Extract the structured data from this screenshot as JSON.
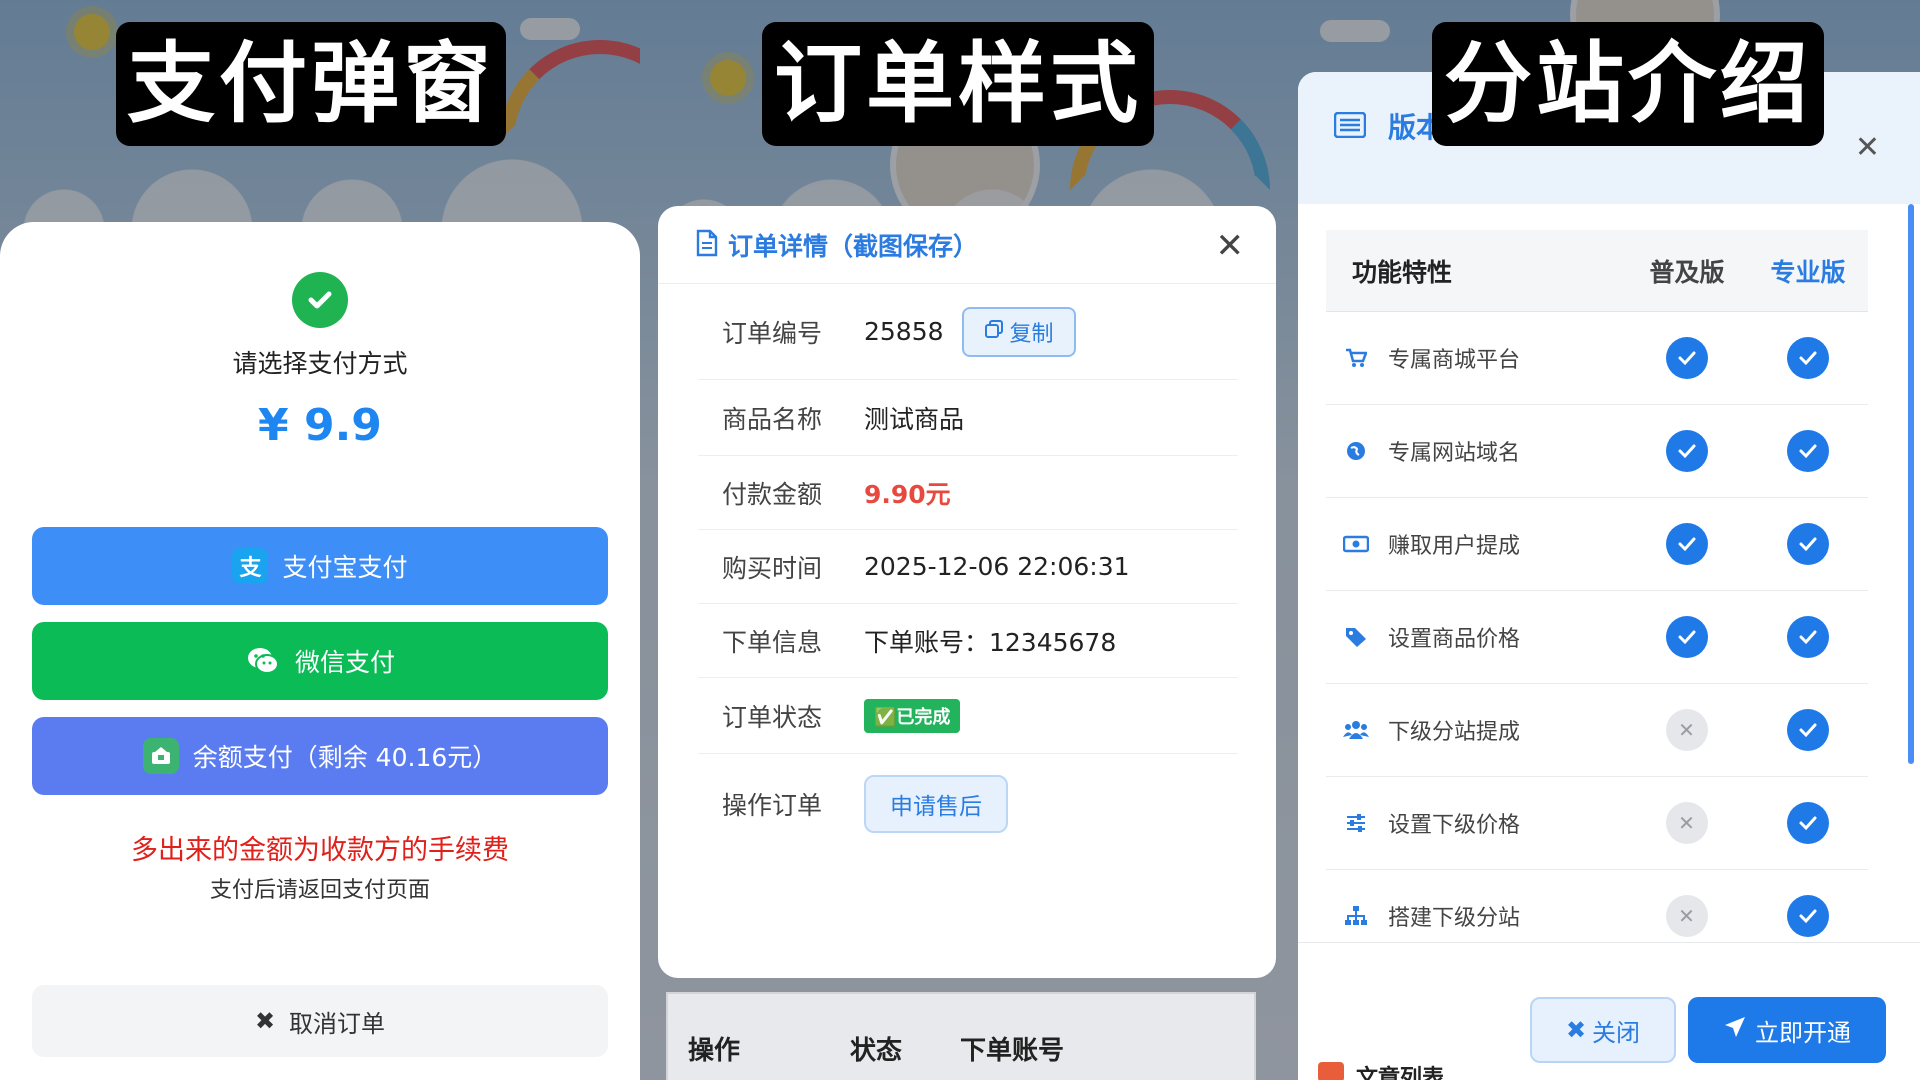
{
  "captions": {
    "payment": "支付弹窗",
    "order": "订单样式",
    "substation": "分站介绍"
  },
  "payment": {
    "title": "请选择支付方式",
    "amount": "¥ 9.9",
    "methods": [
      {
        "label": "支付宝支付",
        "icon": "alipay-icon",
        "icon_glyph": "支",
        "color": "#3d8ef7"
      },
      {
        "label": "微信支付",
        "icon": "wechat-icon",
        "icon_glyph": "",
        "color": "#0bbc56"
      },
      {
        "label": "余额支付（剩余 40.16元）",
        "icon": "wallet-icon",
        "icon_glyph": "",
        "color": "#5b7cf0"
      }
    ],
    "fee_note": "多出来的金额为收款方的手续费",
    "return_note": "支付后请返回支付页面",
    "cancel_label": "取消订单"
  },
  "order": {
    "title": "订单详情（截图保存）",
    "rows": [
      {
        "label": "订单编号",
        "value": "25858"
      },
      {
        "label": "商品名称",
        "value": "测试商品"
      },
      {
        "label": "付款金额",
        "value": "9.90元"
      },
      {
        "label": "购买时间",
        "value": "2025-12-06 22:06:31"
      },
      {
        "label": "下单信息",
        "value": "下单账号：12345678"
      },
      {
        "label": "订单状态",
        "value": "✅已完成"
      },
      {
        "label": "操作订单",
        "value": "申请售后"
      }
    ],
    "copy_label": "复制",
    "amount_color": "#e8493f",
    "table_headers": [
      "操作",
      "状态",
      "下单账号"
    ]
  },
  "version": {
    "title": "版本",
    "columns": [
      "功能特性",
      "普及版",
      "专业版"
    ],
    "features": [
      {
        "name": "专属商城平台",
        "icon": "cart-icon",
        "basic": true,
        "pro": true
      },
      {
        "name": "专属网站域名",
        "icon": "globe-icon",
        "basic": true,
        "pro": true
      },
      {
        "name": "赚取用户提成",
        "icon": "money-icon",
        "basic": true,
        "pro": true
      },
      {
        "name": "设置商品价格",
        "icon": "tags-icon",
        "basic": true,
        "pro": true
      },
      {
        "name": "下级分站提成",
        "icon": "users-icon",
        "basic": false,
        "pro": true
      },
      {
        "name": "设置下级价格",
        "icon": "sliders-icon",
        "basic": false,
        "pro": true
      },
      {
        "name": "搭建下级分站",
        "icon": "sitemap-icon",
        "basic": false,
        "pro": true
      }
    ],
    "close_label": "关闭",
    "open_label": "立即开通",
    "article_list_label": "文章列表"
  },
  "colors": {
    "accent": "#1e7ae8",
    "success": "#20b351",
    "danger": "#e0201b"
  }
}
